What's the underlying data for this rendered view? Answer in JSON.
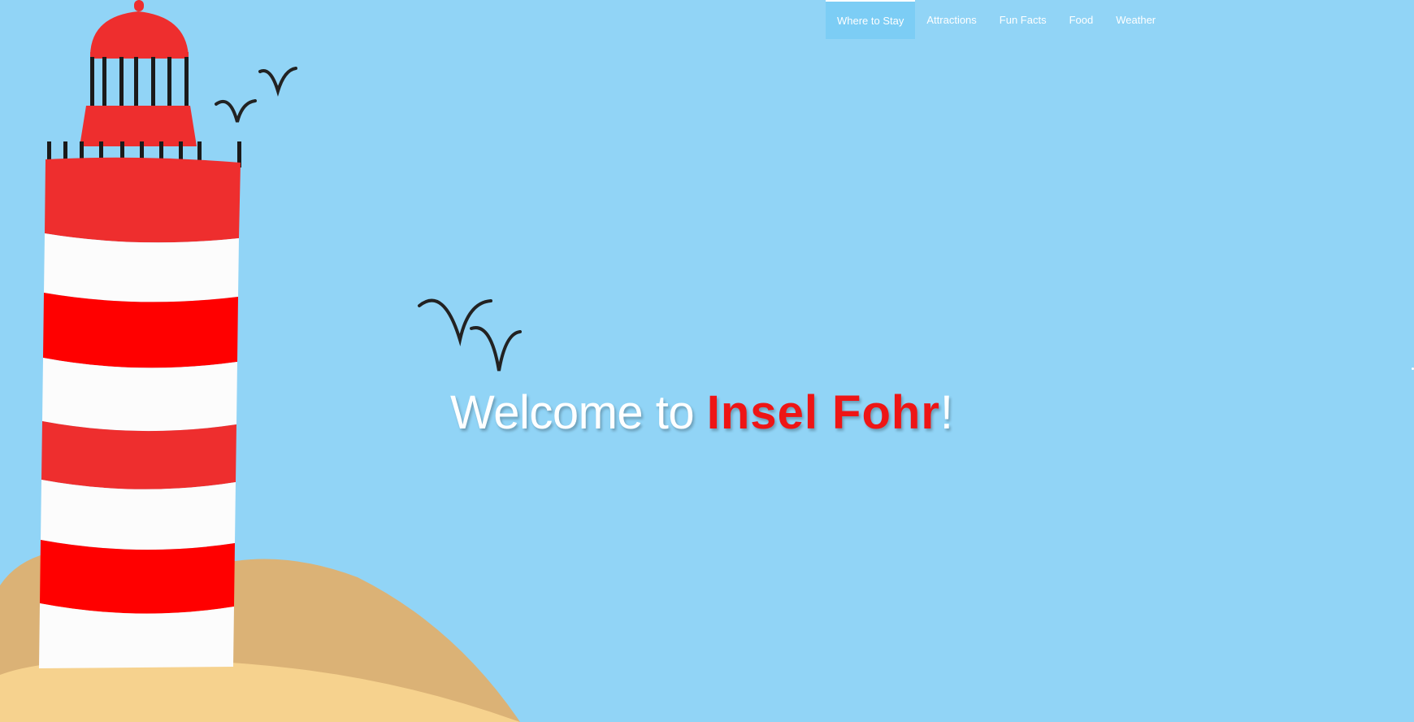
{
  "nav": {
    "items": [
      {
        "label": "Where to Stay",
        "active": true
      },
      {
        "label": "Attractions",
        "active": false
      },
      {
        "label": "Fun Facts",
        "active": false
      },
      {
        "label": "Food",
        "active": false
      },
      {
        "label": "Weather",
        "active": false
      }
    ]
  },
  "hero": {
    "welcome": "Welcome to ",
    "island": "Insel Fohr",
    "exclaim": "!"
  },
  "colors": {
    "sky": "#91d4f6",
    "nav_active": "#7ccdf5",
    "lighthouse_red": "#ee2e2e",
    "lighthouse_white": "#fcfcfc",
    "dune_dark": "#dbb276",
    "dune_light": "#f6d28e",
    "headline_accent": "#ee1515"
  },
  "icons": [
    "lighthouse-illustration",
    "bird-icon"
  ]
}
